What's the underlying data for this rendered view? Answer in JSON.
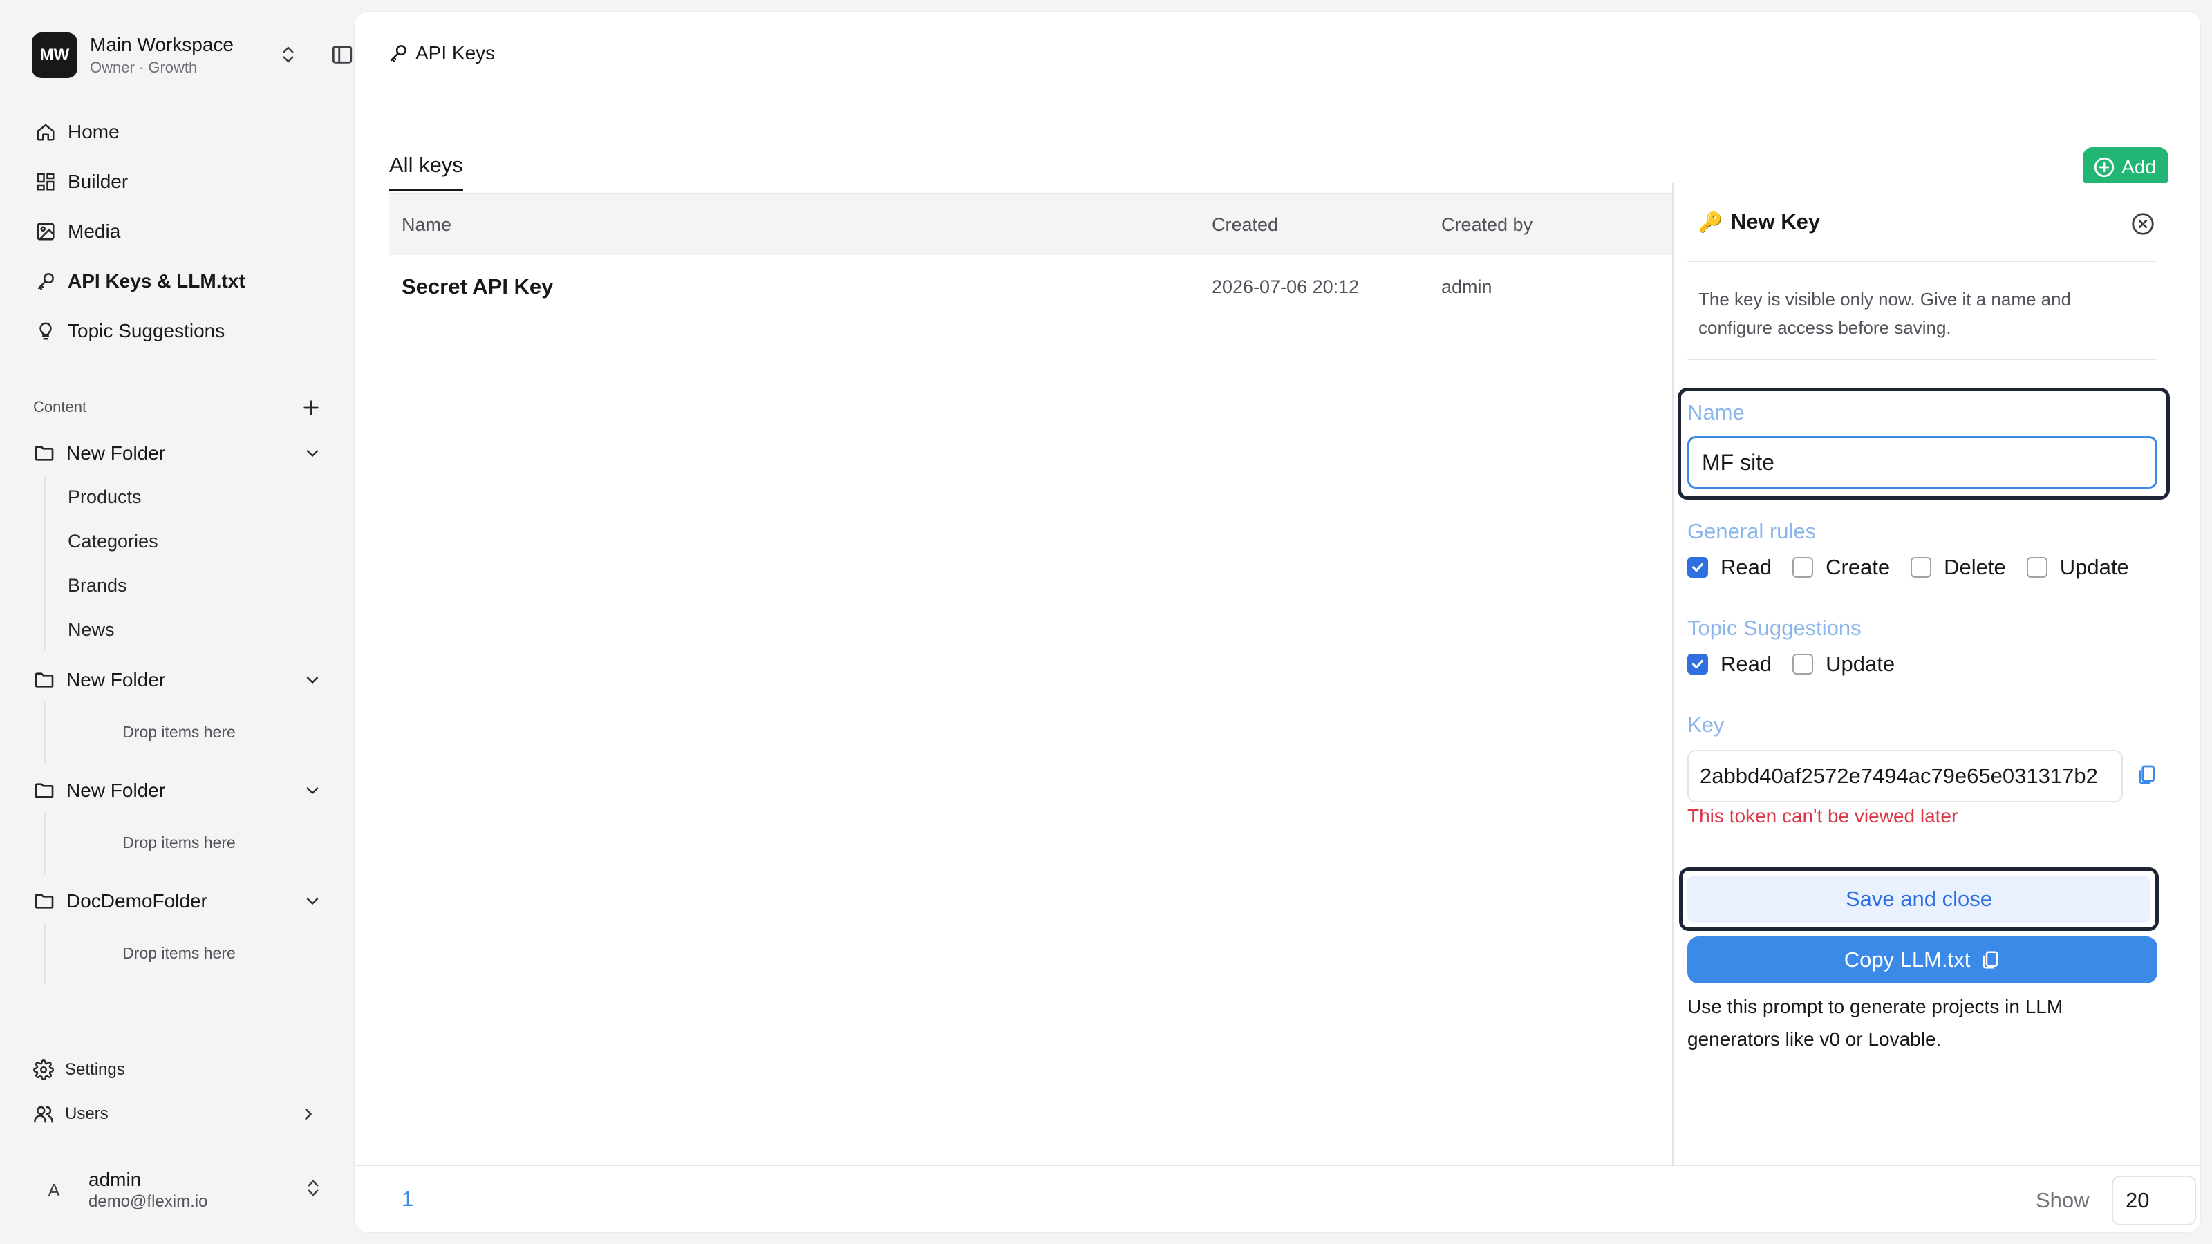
{
  "workspace": {
    "initials": "MW",
    "name": "Main Workspace",
    "subtitle": "Owner · Growth"
  },
  "nav": [
    {
      "label": "Home",
      "icon": "home-icon"
    },
    {
      "label": "Builder",
      "icon": "grid-icon"
    },
    {
      "label": "Media",
      "icon": "image-icon"
    },
    {
      "label": "API Keys & LLM.txt",
      "icon": "key-icon"
    },
    {
      "label": "Topic Suggestions",
      "icon": "lightbulb-icon"
    }
  ],
  "content": {
    "label": "Content",
    "folders": [
      {
        "name": "New Folder",
        "items": [
          "Products",
          "Categories",
          "Brands",
          "News"
        ]
      },
      {
        "name": "New Folder",
        "drop": "Drop items here"
      },
      {
        "name": "New Folder",
        "drop": "Drop items here"
      },
      {
        "name": "DocDemoFolder",
        "drop": "Drop items here"
      }
    ]
  },
  "footer_nav": {
    "settings": "Settings",
    "users": "Users"
  },
  "user": {
    "initial": "A",
    "name": "admin",
    "email": "demo@flexim.io"
  },
  "page": {
    "title": "API Keys"
  },
  "tabs": {
    "active": "All keys",
    "add_label": "Add"
  },
  "table": {
    "headers": {
      "name": "Name",
      "created": "Created",
      "created_by": "Created by"
    },
    "rows": [
      {
        "name": "Secret API Key",
        "created": "2026-07-06 20:12",
        "created_by": "admin"
      }
    ]
  },
  "panel": {
    "emoji": "🔑",
    "title": "New Key",
    "description": "The key is visible only now. Give it a name and configure access before saving.",
    "name_label": "Name",
    "name_value": "MF site",
    "general_rules_label": "General rules",
    "general_rules": [
      {
        "label": "Read",
        "checked": true
      },
      {
        "label": "Create",
        "checked": false
      },
      {
        "label": "Delete",
        "checked": false
      },
      {
        "label": "Update",
        "checked": false
      }
    ],
    "topic_label": "Topic Suggestions",
    "topic_rules": [
      {
        "label": "Read",
        "checked": true
      },
      {
        "label": "Update",
        "checked": false
      }
    ],
    "key_label": "Key",
    "key_value": "2abbd40af2572e7494ac79e65e031317b2",
    "warning": "This token can't be viewed later",
    "save_label": "Save and close",
    "copy_label": "Copy LLM.txt",
    "hint": "Use this prompt to generate projects in LLM generators like v0 or Lovable."
  },
  "pagination": {
    "current": "1",
    "show_label": "Show",
    "page_size": "20"
  },
  "colors": {
    "accent": "#3b8ae8",
    "add_green": "#22b573",
    "warning": "#dc3545",
    "label_blue": "#8cb6ea"
  }
}
